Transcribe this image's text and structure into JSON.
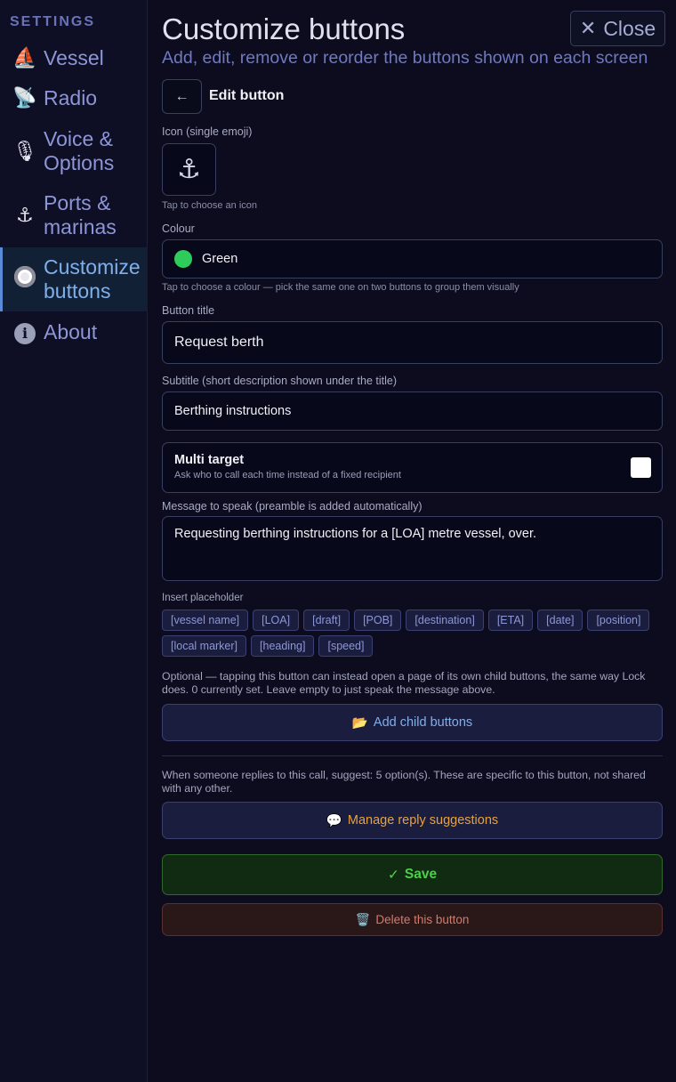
{
  "sidebar": {
    "heading": "SETTINGS",
    "items": [
      {
        "label": "Vessel",
        "icon": "⛵",
        "icon_name": "sailboat-icon"
      },
      {
        "label": "Radio",
        "icon": "📡",
        "icon_name": "satellite-dish-icon"
      },
      {
        "label": "Voice & Options",
        "icon": "🎙",
        "icon_name": "microphone-icon"
      },
      {
        "label": "Ports & marinas",
        "icon": "⚓",
        "icon_name": "anchor-icon"
      },
      {
        "label": "Customize buttons",
        "icon": "",
        "icon_name": "record-button-icon",
        "active": true
      },
      {
        "label": "About",
        "icon": "i",
        "icon_name": "info-icon"
      }
    ]
  },
  "header": {
    "title": "Customize buttons",
    "subtitle": "Add, edit, remove or reorder the buttons shown on each screen",
    "close_label": "Close",
    "close_glyph": "✕"
  },
  "editor": {
    "back_glyph": "←",
    "title": "Edit button",
    "icon_label": "Icon (single emoji)",
    "icon_value": "⚓",
    "icon_hint": "Tap to choose an icon",
    "colour_label": "Colour",
    "colour_value": "Green",
    "colour_hex": "#2ecc5a",
    "colour_hint": "Tap to choose a colour — pick the same one on two buttons to group them visually",
    "button_title_label": "Button title",
    "button_title_value": "Request berth",
    "subtitle_label": "Subtitle (short description shown under the title)",
    "subtitle_value": "Berthing instructions",
    "multi_target_title": "Multi target",
    "multi_target_desc": "Ask who to call each time instead of a fixed recipient",
    "multi_target_checked": false,
    "message_label": "Message to speak (preamble is added automatically)",
    "message_value": "Requesting berthing instructions for a [LOA] metre vessel, over.",
    "placeholder_label": "Insert placeholder",
    "placeholders_row1": [
      "[vessel name]",
      "[LOA]",
      "[draft]",
      "[POB]",
      "[destination]",
      "[ETA]",
      "[date]",
      "[position]"
    ],
    "placeholders_row2": [
      "[local marker]",
      "[heading]",
      "[speed]"
    ],
    "child_info": "Optional — tapping this button can instead open a page of its own child buttons, the same way Lock does. 0 currently set. Leave empty to just speak the message above.",
    "child_button_label": "Add child buttons",
    "child_button_icon": "📂",
    "reply_info": "When someone replies to this call, suggest: 5 option(s). These are specific to this button, not shared with any other.",
    "reply_button_label": "Manage reply suggestions",
    "reply_button_icon": "💬",
    "save_label": "Save",
    "save_icon": "✓",
    "delete_label": "Delete this button",
    "delete_icon": "🗑️"
  }
}
